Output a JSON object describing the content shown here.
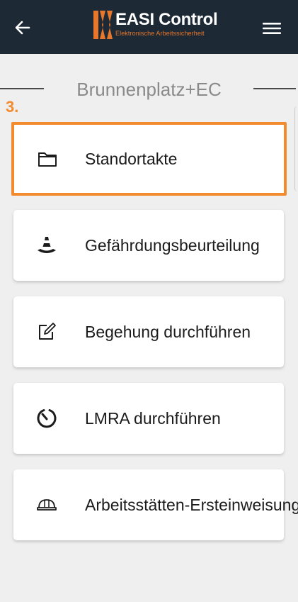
{
  "header": {
    "app_name": "EASI Control",
    "tagline": "Elektronische Arbeitssicherheit",
    "back_icon": "arrow-left-icon",
    "menu_icon": "hamburger-menu-icon",
    "background_color": "#1d2a36",
    "brand_color": "#e8762b"
  },
  "location": {
    "title": "Brunnenplatz+EC"
  },
  "step_marker": "3.",
  "highlight_color": "#f28a2e",
  "menu": {
    "items": [
      {
        "label": "Standortakte",
        "icon": "folder-icon",
        "highlighted": true
      },
      {
        "label": "Gefährdungsbeurteilung",
        "icon": "traffic-cone-icon",
        "highlighted": false
      },
      {
        "label": "Begehung durchführen",
        "icon": "edit-note-icon",
        "highlighted": false
      },
      {
        "label": "LMRA durchführen",
        "icon": "timer-icon",
        "highlighted": false
      },
      {
        "label": "Arbeitsstätten-Ersteinweisung",
        "icon": "hard-hat-icon",
        "highlighted": false
      }
    ]
  }
}
